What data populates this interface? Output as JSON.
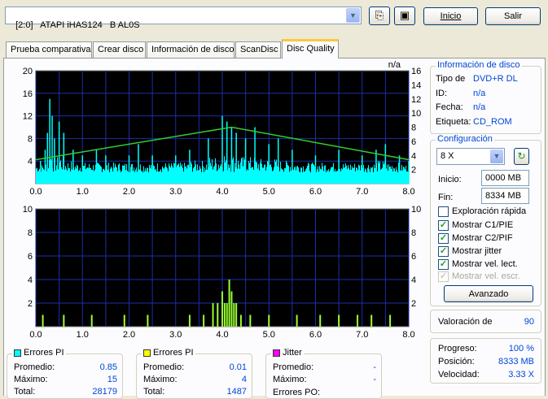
{
  "toolbar": {
    "drive": "[2:0]   ATAPI iHAS124   B AL0S",
    "start_label": "Inicio",
    "exit_label": "Salir"
  },
  "tabs": [
    {
      "label": "Prueba comparativa"
    },
    {
      "label": "Crear disco"
    },
    {
      "label": "Información de disco"
    },
    {
      "label": "ScanDisc"
    },
    {
      "label": "Disc Quality"
    }
  ],
  "chart_top": {
    "corner_label": "n/a",
    "y_left_ticks": [
      "20",
      "16",
      "12",
      "8",
      "4"
    ],
    "y_right_ticks": [
      "16",
      "14",
      "12",
      "10",
      "8",
      "6",
      "4",
      "2"
    ],
    "x_ticks": [
      "0.0",
      "1.0",
      "2.0",
      "3.0",
      "4.0",
      "5.0",
      "6.0",
      "7.0",
      "8.0"
    ]
  },
  "chart_bottom": {
    "y_left_ticks": [
      "10",
      "8",
      "6",
      "4",
      "2"
    ],
    "y_right_ticks": [
      "10",
      "8",
      "6",
      "4",
      "2"
    ],
    "x_ticks": [
      "0.0",
      "1.0",
      "2.0",
      "3.0",
      "4.0",
      "5.0",
      "6.0",
      "7.0",
      "8.0"
    ]
  },
  "chart_data": [
    {
      "type": "bar",
      "description_series": [
        "PI errors",
        "read speed"
      ],
      "x_range": [
        0,
        8
      ],
      "ylim": [
        0,
        20
      ],
      "y2lim": [
        0,
        16
      ],
      "series": [
        {
          "name": "Errores PI",
          "color": "#00ffff",
          "peaks": [
            [
              0.1,
              4
            ],
            [
              0.2,
              6
            ],
            [
              0.25,
              9
            ],
            [
              0.3,
              15
            ],
            [
              0.35,
              12
            ],
            [
              0.4,
              8
            ],
            [
              0.5,
              11
            ],
            [
              0.6,
              9
            ],
            [
              0.8,
              6
            ],
            [
              1.0,
              5
            ],
            [
              1.3,
              6
            ],
            [
              1.5,
              5
            ],
            [
              2.0,
              5
            ],
            [
              2.2,
              7
            ],
            [
              2.5,
              5
            ],
            [
              3.0,
              5
            ],
            [
              3.3,
              6
            ],
            [
              3.7,
              8
            ],
            [
              4.0,
              12
            ],
            [
              4.1,
              11
            ],
            [
              4.2,
              10
            ],
            [
              4.3,
              9
            ],
            [
              4.5,
              8
            ],
            [
              4.7,
              10
            ],
            [
              5.0,
              7
            ],
            [
              5.2,
              8
            ],
            [
              5.5,
              6
            ],
            [
              6.0,
              5
            ],
            [
              6.5,
              6
            ],
            [
              7.0,
              5
            ],
            [
              7.3,
              6
            ],
            [
              7.5,
              7
            ],
            [
              7.8,
              5
            ],
            [
              8.0,
              4
            ]
          ]
        },
        {
          "name": "Velocidad",
          "color": "#33cc33",
          "points": [
            [
              0.0,
              3.4
            ],
            [
              4.2,
              8.0
            ],
            [
              8.0,
              3.4
            ]
          ]
        }
      ]
    },
    {
      "type": "bar",
      "x_range": [
        0,
        8
      ],
      "ylim": [
        0,
        10
      ],
      "series": [
        {
          "name": "Errores PI",
          "color": "#99ff33",
          "peaks": [
            [
              0.15,
              1
            ],
            [
              0.6,
              1
            ],
            [
              1.2,
              1
            ],
            [
              1.9,
              1
            ],
            [
              2.4,
              1
            ],
            [
              3.3,
              1
            ],
            [
              3.6,
              1
            ],
            [
              3.8,
              2
            ],
            [
              3.9,
              2
            ],
            [
              4.0,
              3
            ],
            [
              4.05,
              2
            ],
            [
              4.1,
              2
            ],
            [
              4.15,
              4
            ],
            [
              4.2,
              3
            ],
            [
              4.25,
              2
            ],
            [
              4.3,
              2
            ],
            [
              4.4,
              1
            ],
            [
              4.6,
              1
            ],
            [
              5.0,
              1
            ],
            [
              5.6,
              1
            ],
            [
              6.1,
              1
            ],
            [
              6.5,
              1
            ],
            [
              6.9,
              1
            ],
            [
              7.2,
              1
            ],
            [
              7.6,
              1
            ]
          ]
        }
      ]
    }
  ],
  "disc_info": {
    "title": "Información de disco",
    "type_label": "Tipo de",
    "type_value": "DVD+R DL",
    "id_label": "ID:",
    "id_value": "n/a",
    "date_label": "Fecha:",
    "date_value": "n/a",
    "tag_label": "Etiqueta:",
    "tag_value": "CD_ROM"
  },
  "config": {
    "title": "Configuración",
    "speed": "8 X",
    "start_label": "Inicio:",
    "start_value": "0000 MB",
    "end_label": "Fin:",
    "end_value": "8334 MB",
    "quick_scan": "Exploración rápida",
    "show_c1": "Mostrar C1/PIE",
    "show_c2": "Mostrar C2/PIF",
    "show_jitter": "Mostrar jitter",
    "show_speed": "Mostrar vel. lect.",
    "show_write": "Mostrar vel. escr.",
    "advanced": "Avanzado"
  },
  "rating": {
    "label": "Valoración de",
    "value": "90"
  },
  "progress": {
    "progress_label": "Progreso:",
    "progress_value": "100 %",
    "position_label": "Posición:",
    "position_value": "8333 MB",
    "speed_label": "Velocidad:",
    "speed_value": "3.33 X"
  },
  "stats": {
    "pi": {
      "title": "Errores PI",
      "color": "#00ffff",
      "avg_label": "Promedio:",
      "avg": "0.85",
      "max_label": "Máximo:",
      "max": "15",
      "total_label": "Total:",
      "total": "28179"
    },
    "pif": {
      "title": "Errores PI",
      "color": "#ffff00",
      "avg_label": "Promedio:",
      "avg": "0.01",
      "max_label": "Máximo:",
      "max": "4",
      "total_label": "Total:",
      "total": "1487"
    },
    "jitter": {
      "title": "Jitter",
      "color": "#ff00ff",
      "avg_label": "Promedio:",
      "avg": "-",
      "max_label": "Máximo:",
      "max": "-",
      "po_label": "Errores PO:",
      "po": "-"
    }
  }
}
